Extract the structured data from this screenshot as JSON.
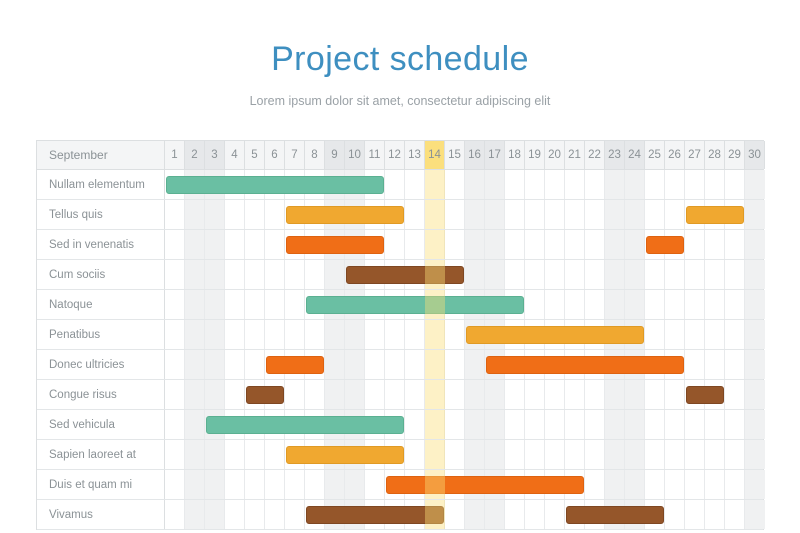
{
  "header": {
    "title": "Project schedule",
    "subtitle": "Lorem ipsum dolor sit amet, consectetur adipiscing elit"
  },
  "chart_data": {
    "type": "bar",
    "title": "Project schedule",
    "subtitle": "Lorem ipsum dolor sit amet, consectetur adipiscing elit",
    "month_label": "September",
    "xlabel": "",
    "ylabel": "",
    "days": [
      1,
      2,
      3,
      4,
      5,
      6,
      7,
      8,
      9,
      10,
      11,
      12,
      13,
      14,
      15,
      16,
      17,
      18,
      19,
      20,
      21,
      22,
      23,
      24,
      25,
      26,
      27,
      28,
      29,
      30
    ],
    "day_count": 30,
    "today": 14,
    "shaded_days": [
      2,
      3,
      9,
      10,
      16,
      17,
      23,
      24,
      30
    ],
    "colors": {
      "green": "#6ABFA3",
      "yellow": "#F0A830",
      "orange": "#F06E17",
      "brown": "#95562A",
      "today_highlight": "#FBDF7D",
      "title": "#3E8FC0",
      "text": "#8B9296",
      "grid": "#E8EAEC",
      "border": "#DCDFE1",
      "shade": "#F0F1F2"
    },
    "tasks": [
      {
        "name": "Nullam elementum",
        "bars": [
          {
            "start": 1,
            "end": 11,
            "color": "green"
          }
        ]
      },
      {
        "name": "Tellus quis",
        "bars": [
          {
            "start": 7,
            "end": 12,
            "color": "yellow"
          },
          {
            "start": 27,
            "end": 29,
            "color": "yellow"
          }
        ]
      },
      {
        "name": "Sed in venenatis",
        "bars": [
          {
            "start": 7,
            "end": 11,
            "color": "orange"
          },
          {
            "start": 25,
            "end": 26,
            "color": "orange"
          }
        ]
      },
      {
        "name": "Cum sociis",
        "bars": [
          {
            "start": 10,
            "end": 15,
            "color": "brown"
          }
        ]
      },
      {
        "name": "Natoque",
        "bars": [
          {
            "start": 8,
            "end": 18,
            "color": "green"
          }
        ]
      },
      {
        "name": "Penatibus",
        "bars": [
          {
            "start": 16,
            "end": 24,
            "color": "yellow"
          }
        ]
      },
      {
        "name": "Donec ultricies",
        "bars": [
          {
            "start": 6,
            "end": 8,
            "color": "orange"
          },
          {
            "start": 17,
            "end": 26,
            "color": "orange"
          }
        ]
      },
      {
        "name": "Congue risus",
        "bars": [
          {
            "start": 5,
            "end": 6,
            "color": "brown"
          },
          {
            "start": 27,
            "end": 28,
            "color": "brown"
          }
        ]
      },
      {
        "name": "Sed vehicula",
        "bars": [
          {
            "start": 3,
            "end": 12,
            "color": "green"
          }
        ]
      },
      {
        "name": "Sapien laoreet at",
        "bars": [
          {
            "start": 7,
            "end": 12,
            "color": "yellow"
          }
        ]
      },
      {
        "name": "Duis et quam mi",
        "bars": [
          {
            "start": 12,
            "end": 21,
            "color": "orange"
          }
        ]
      },
      {
        "name": "Vivamus",
        "bars": [
          {
            "start": 8,
            "end": 14,
            "color": "brown"
          },
          {
            "start": 21,
            "end": 25,
            "color": "brown"
          }
        ]
      }
    ]
  }
}
